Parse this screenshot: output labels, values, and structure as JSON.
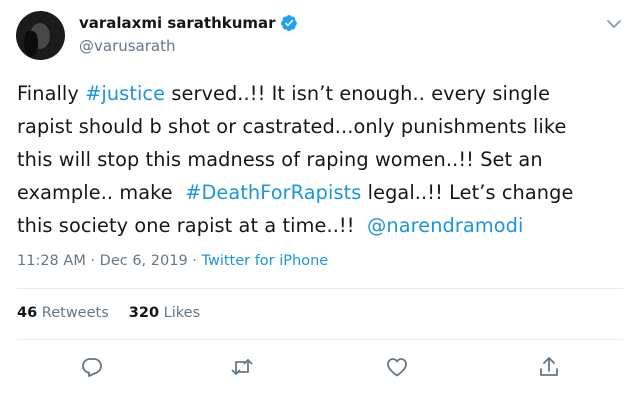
{
  "author": {
    "display_name": "varalaxmi sarathkumar",
    "handle": "@varusarath"
  },
  "tweet": {
    "lines": [
      [
        "Finally ",
        "#justice",
        " served..!! It isn’t enough.. every single"
      ],
      [
        "rapist should b shot or castrated...only punishments like",
        "",
        ""
      ],
      [
        "this will stop this madness of raping women..!! Set an",
        "",
        ""
      ],
      [
        "example.. make  ",
        "#DeathForRapists",
        " legal..!! Let’s change"
      ],
      [
        "this society one rapist at a time..!!  ",
        "@narendramodi",
        ""
      ]
    ]
  },
  "meta": {
    "time": "11:28 AM",
    "separator1": " · ",
    "date": "Dec 6, 2019",
    "separator2": " · ",
    "source": "Twitter for iPhone"
  },
  "stats": {
    "retweets_count": "46",
    "retweets_label": "Retweets",
    "likes_count": "320",
    "likes_label": "Likes"
  },
  "colors": {
    "link": "#1b95e0",
    "text": "#14171a",
    "muted": "#657786",
    "divider": "#e6ecf0"
  },
  "icons": [
    "verified-badge-icon",
    "chevron-down-icon",
    "reply-icon",
    "retweet-icon",
    "like-icon",
    "share-icon"
  ]
}
